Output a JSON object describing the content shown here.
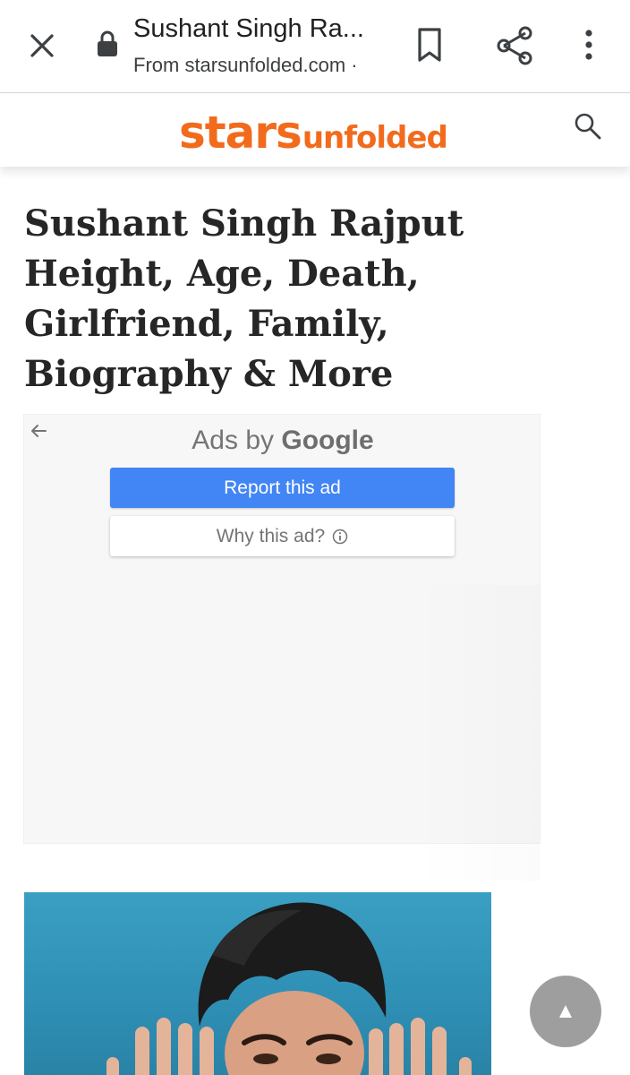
{
  "toolbar": {
    "title": "Sushant Singh Ra...",
    "url": "From starsunfolded.com ·",
    "icons": [
      "close-icon",
      "lock-icon",
      "bookmark-icon",
      "share-icon",
      "more-vert-icon"
    ]
  },
  "site": {
    "logo_part1": "stars",
    "logo_part2": "unfolded",
    "brand_color": "#f26b1d",
    "search_icon": "search-icon"
  },
  "article": {
    "headline": "Sushant Singh Rajput Height, Age, Death, Girlfriend, Family, Biography & More"
  },
  "ad": {
    "heading_prefix": "Ads by",
    "heading_brand": "Google",
    "report_label": "Report this ad",
    "why_label": "Why this ad?",
    "accent": "#4285f4"
  },
  "fab": {
    "symbol": "▲"
  }
}
